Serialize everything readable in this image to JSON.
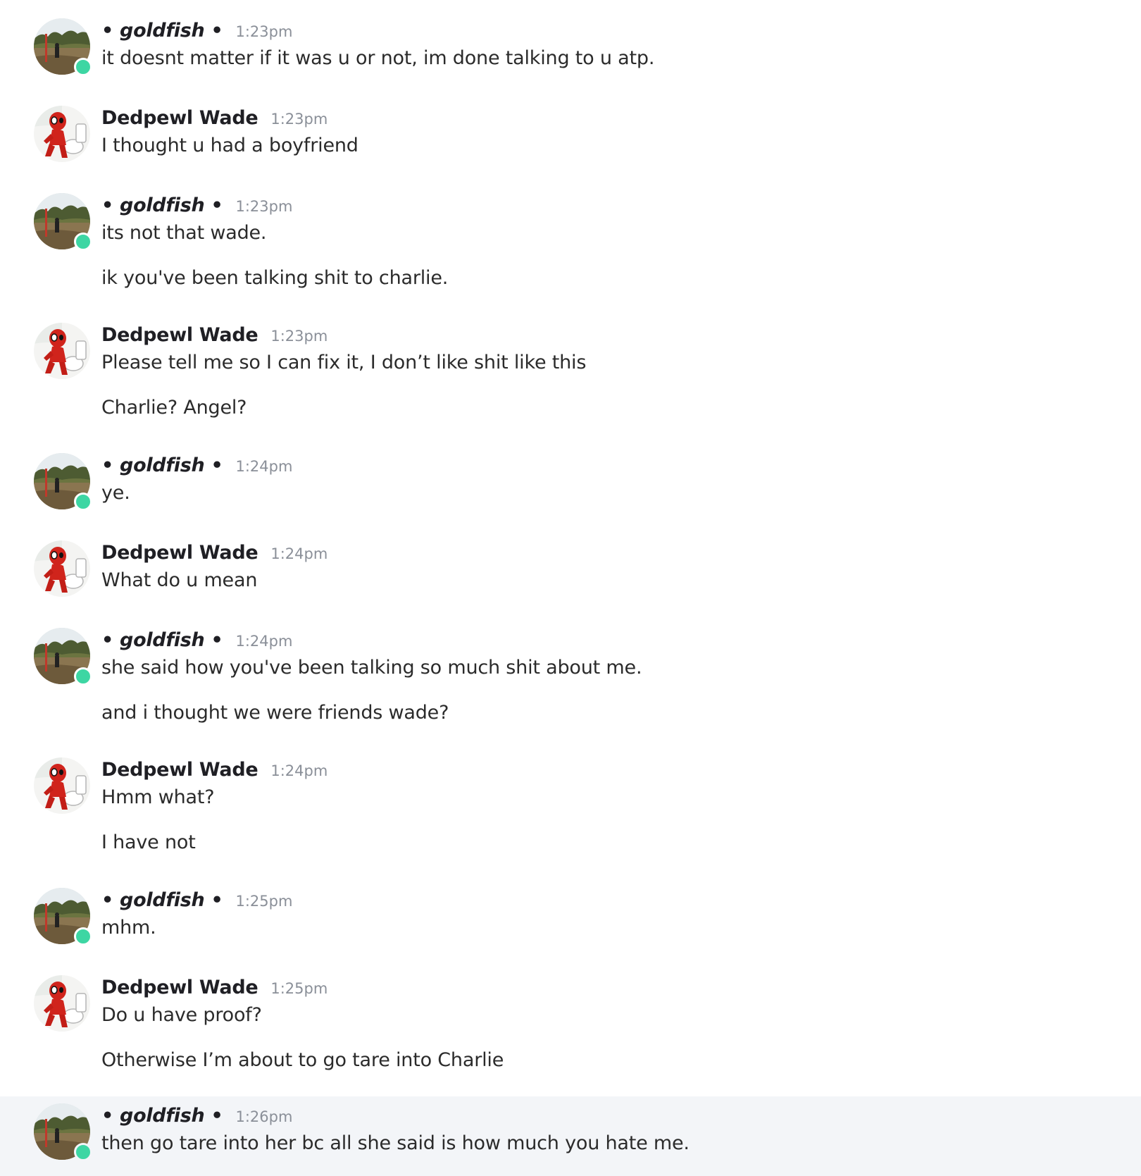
{
  "users": {
    "goldfish": {
      "display_name": "• goldfish •",
      "avatar_icon": "landscape-photo-avatar",
      "online_color": "#3dd6a3"
    },
    "wade": {
      "display_name": "Dedpewl Wade",
      "avatar_icon": "red-cartoon-avatar"
    }
  },
  "messages": [
    {
      "author": "• goldfish •",
      "time": "1:23pm",
      "lines": [
        "it doesnt matter if it was u or not, im done talking to u atp."
      ]
    },
    {
      "author": "Dedpewl Wade",
      "time": "1:23pm",
      "lines": [
        "I thought u had a boyfriend"
      ]
    },
    {
      "author": "• goldfish •",
      "time": "1:23pm",
      "lines": [
        "its not that wade.",
        "ik you've been talking shit to charlie."
      ]
    },
    {
      "author": "Dedpewl Wade",
      "time": "1:23pm",
      "lines": [
        "Please tell me so I can fix it, I don’t like shit like this",
        "Charlie? Angel?"
      ]
    },
    {
      "author": "• goldfish •",
      "time": "1:24pm",
      "lines": [
        "ye."
      ]
    },
    {
      "author": "Dedpewl Wade",
      "time": "1:24pm",
      "lines": [
        "What do u mean"
      ]
    },
    {
      "author": "• goldfish •",
      "time": "1:24pm",
      "lines": [
        "she said how you've been talking so much shit about me.",
        "and i thought we were friends wade?"
      ]
    },
    {
      "author": "Dedpewl Wade",
      "time": "1:24pm",
      "lines": [
        "Hmm what?",
        "I have not"
      ]
    },
    {
      "author": "• goldfish •",
      "time": "1:25pm",
      "lines": [
        "mhm."
      ]
    },
    {
      "author": "Dedpewl Wade",
      "time": "1:25pm",
      "lines": [
        "Do u have proof?",
        "Otherwise I’m about to go tare into Charlie"
      ]
    },
    {
      "author": "• goldfish •",
      "time": "1:26pm",
      "lines": [
        "then go tare into her bc all she said is how much you hate me."
      ]
    }
  ]
}
